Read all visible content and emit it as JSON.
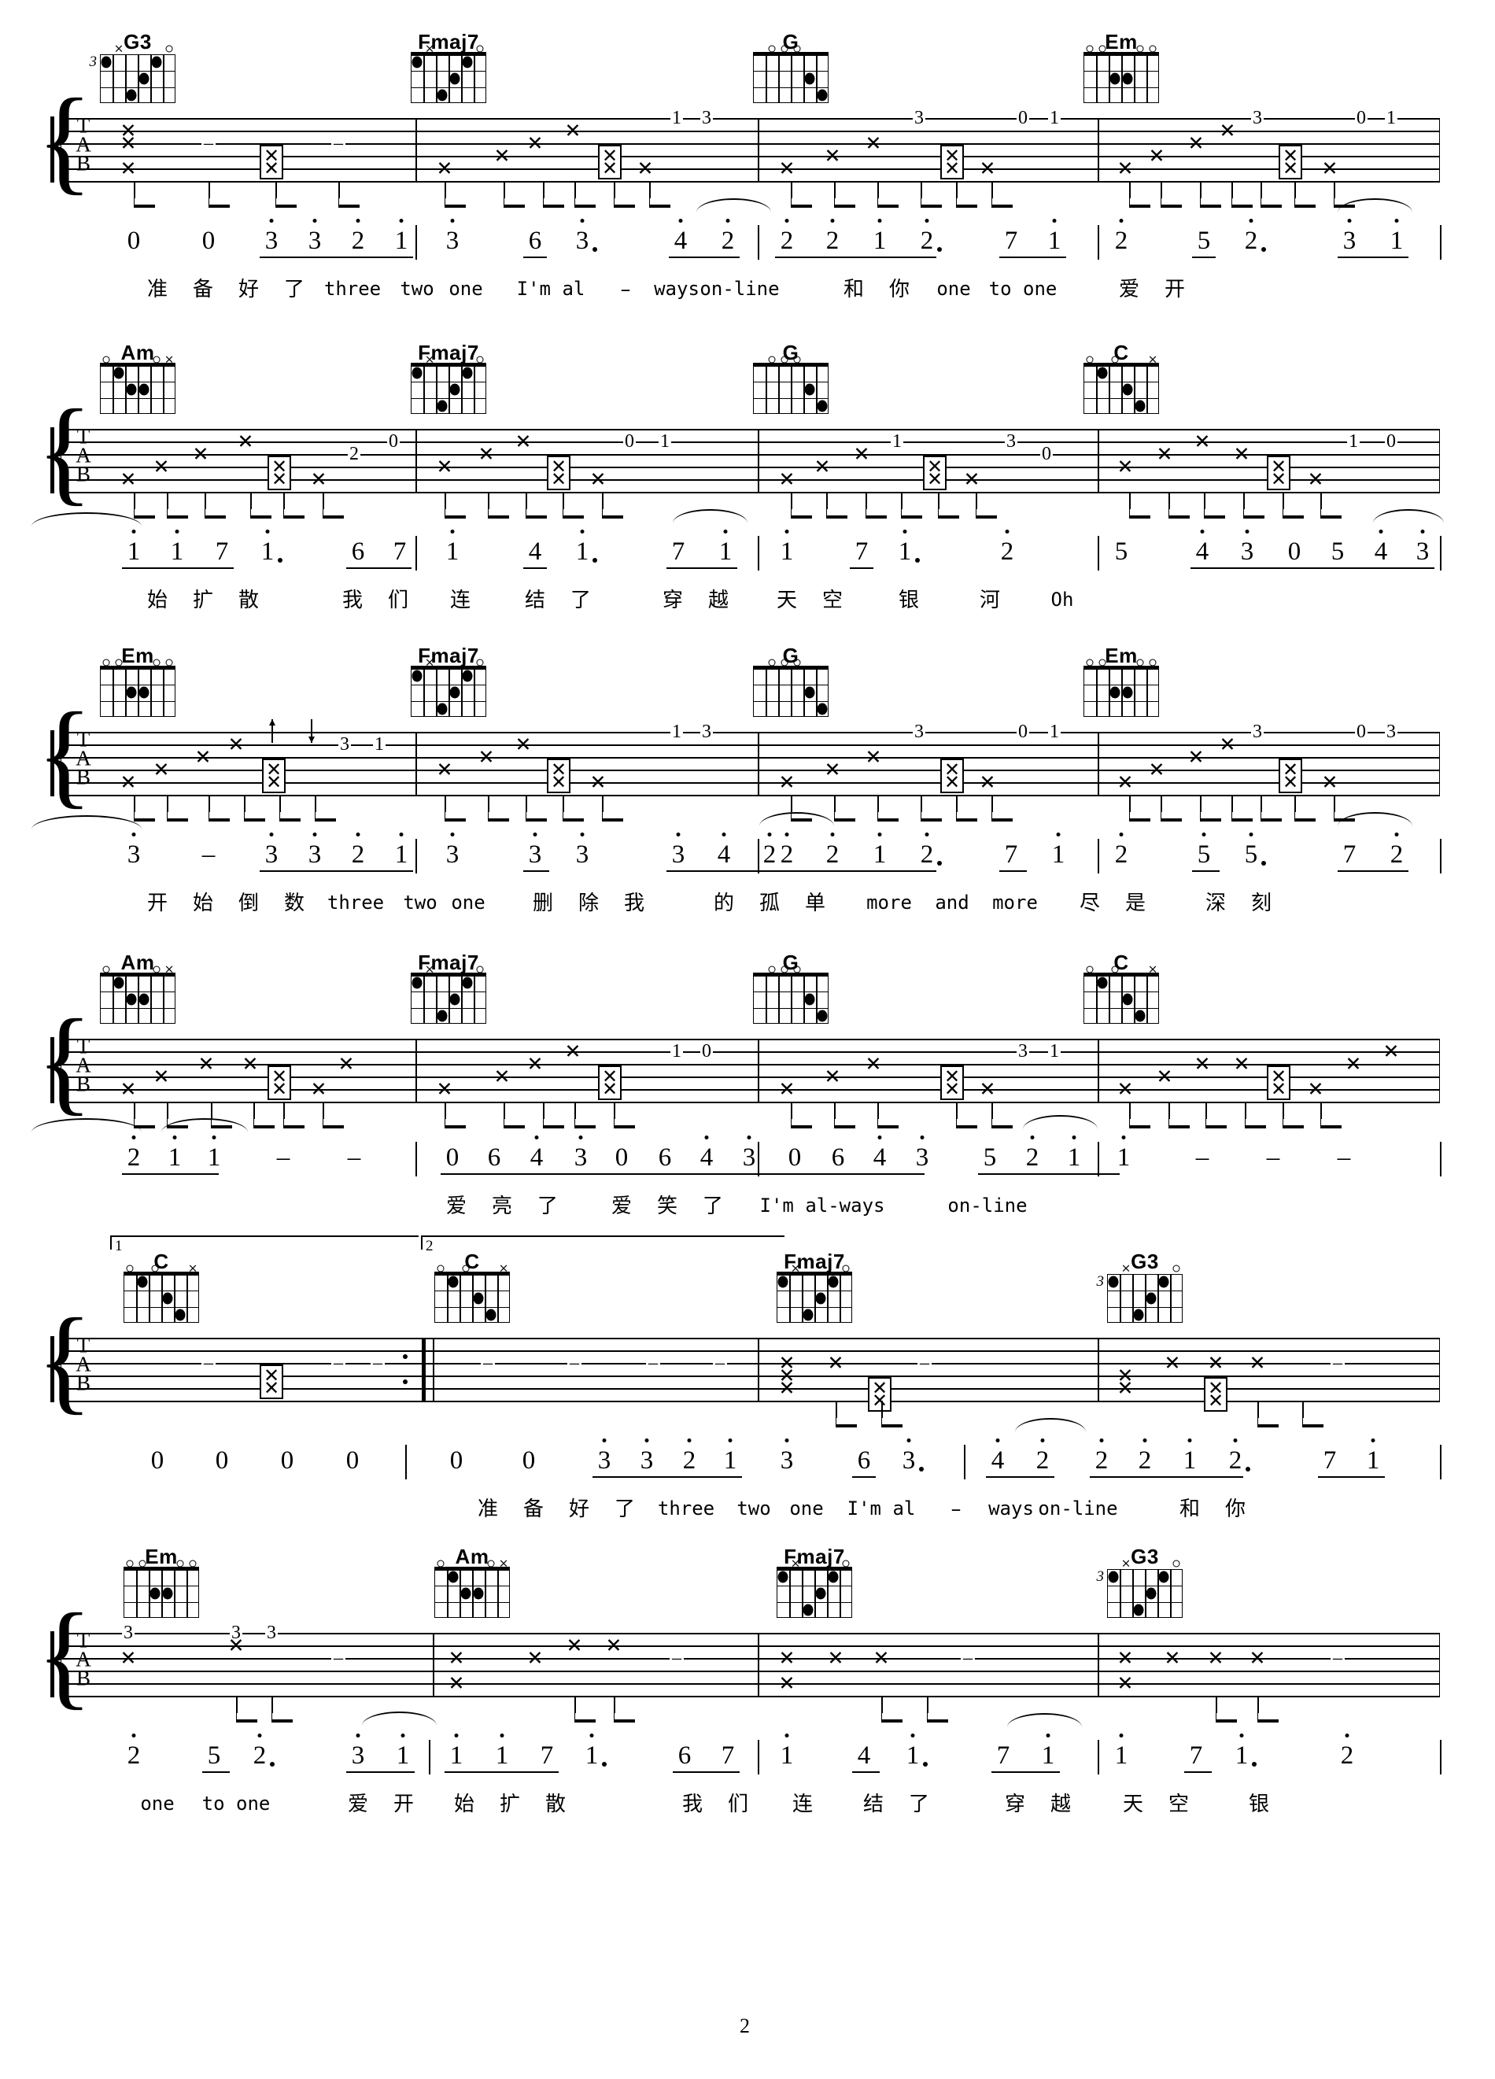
{
  "page": {
    "number": "2"
  },
  "systems": [
    {
      "id": "system-1",
      "chords": [
        "G3",
        "Fmaj7",
        "G",
        "Em"
      ],
      "tab_numbers": [
        "1",
        "3",
        "3",
        "0",
        "1",
        "3",
        "0",
        "1"
      ],
      "jianpu": "0  0  3 3 2 1 | 3  6 3. | 4 2 | 2 2 1 2. | 7 1 | 2  5 2. | 3 1 |",
      "notes": [
        "0",
        "0",
        "3",
        "3",
        "2",
        "1",
        "3",
        "6",
        "3.",
        "4",
        "2",
        "2",
        "2",
        "1",
        "2.",
        "7",
        "1",
        "2",
        "5",
        "2.",
        "3",
        "1"
      ],
      "lyrics": [
        "准",
        "备",
        "好",
        "了",
        "three",
        "two",
        "one",
        "I'm al",
        "-",
        "ways",
        "on-line",
        "和",
        "你",
        "one",
        "to one",
        "爱",
        "开"
      ]
    },
    {
      "id": "system-2",
      "chords": [
        "Am",
        "Fmaj7",
        "G",
        "C"
      ],
      "tab_numbers": [
        "2",
        "0",
        "0",
        "1",
        "1",
        "3",
        "0",
        "1",
        "0"
      ],
      "notes": [
        "1",
        "1",
        "7",
        "1.",
        "6",
        "7",
        "1",
        "4",
        "1.",
        "7",
        "1",
        "1",
        "7",
        "1.",
        "2",
        "5",
        "4",
        "3",
        "0",
        "5",
        "4",
        "3"
      ],
      "lyrics": [
        "始",
        "扩",
        "散",
        "我",
        "们",
        "连",
        "结",
        "了",
        "穿",
        "越",
        "天",
        "空",
        "银",
        "河",
        "Oh"
      ]
    },
    {
      "id": "system-3",
      "chords": [
        "Em",
        "Fmaj7",
        "G",
        "Em"
      ],
      "tab_numbers": [
        "3",
        "1",
        "1",
        "3",
        "3",
        "0",
        "1",
        "3",
        "0",
        "3"
      ],
      "notes": [
        "3",
        "-",
        "3",
        "3",
        "2",
        "1",
        "3",
        "3",
        "3",
        "3",
        "4",
        "2",
        "2",
        "2",
        "1",
        "2.",
        "7",
        "1",
        "2",
        "5",
        "5.",
        "7",
        "2"
      ],
      "lyrics": [
        "开",
        "始",
        "倒",
        "数",
        "three",
        "two",
        "one",
        "删",
        "除",
        "我",
        "的",
        "孤",
        "单",
        "more",
        "and",
        "more",
        "尽",
        "是",
        "深",
        "刻"
      ]
    },
    {
      "id": "system-4",
      "chords": [
        "Am",
        "Fmaj7",
        "G",
        "C"
      ],
      "tab_numbers": [
        "1",
        "0",
        "3",
        "1"
      ],
      "notes": [
        "2",
        "1",
        "1",
        "-",
        "-",
        "0",
        "6",
        "4",
        "3",
        "0",
        "6",
        "4",
        "3",
        "0",
        "6",
        "4",
        "3",
        "5",
        "2",
        "1",
        "1",
        "-",
        "-",
        "-"
      ],
      "lyrics": [
        "爱",
        "亮",
        "了",
        "爱",
        "笑",
        "了",
        "I'm al-ways",
        "on-line"
      ],
      "volta1": "1",
      "volta2": "2"
    },
    {
      "id": "system-5",
      "chords": [
        "C",
        "C",
        "Fmaj7",
        "G3"
      ],
      "notes": [
        "0",
        "0",
        "0",
        "0",
        "0",
        "0",
        "3",
        "3",
        "2",
        "1",
        "3",
        "6",
        "3.",
        "4",
        "2",
        "2",
        "2",
        "1",
        "2.",
        "7",
        "1"
      ],
      "lyrics": [
        "准",
        "备",
        "好",
        "了",
        "three",
        "two",
        "one",
        "I'm al",
        "-",
        "ways",
        "on-line",
        "和",
        "你"
      ]
    },
    {
      "id": "system-6",
      "chords": [
        "Em",
        "Am",
        "Fmaj7",
        "G3"
      ],
      "tab_numbers": [
        "3",
        "3",
        "3"
      ],
      "notes": [
        "2",
        "5",
        "2.",
        "3",
        "1",
        "1",
        "1",
        "7",
        "1.",
        "6",
        "7",
        "1",
        "4",
        "1.",
        "7",
        "1",
        "1",
        "7",
        "1.",
        "2"
      ],
      "lyrics": [
        "one",
        "to one",
        "爱",
        "开",
        "始",
        "扩",
        "散",
        "我",
        "们",
        "连",
        "结",
        "了",
        "穿",
        "越",
        "天",
        "空",
        "银"
      ]
    }
  ],
  "chord_shapes": {
    "G3": {
      "name": "G3",
      "fret": "3",
      "dots": [
        [
          1,
          1
        ],
        [
          5,
          1
        ],
        [
          4,
          2
        ],
        [
          3,
          3
        ]
      ],
      "open": [
        6
      ],
      "muted": [
        2
      ]
    },
    "Fmaj7": {
      "name": "Fmaj7",
      "fret": "",
      "dots": [
        [
          1,
          1
        ],
        [
          5,
          1
        ],
        [
          4,
          2
        ],
        [
          3,
          3
        ]
      ],
      "open": [
        6
      ],
      "muted": [
        2
      ]
    },
    "G": {
      "name": "G",
      "fret": "",
      "dots": [
        [
          5,
          2
        ],
        [
          6,
          3
        ]
      ],
      "open": [
        2,
        3,
        4
      ]
    },
    "Em": {
      "name": "Em",
      "fret": "",
      "dots": [
        [
          4,
          2
        ],
        [
          3,
          2
        ]
      ],
      "open": [
        1,
        2,
        5,
        6
      ]
    },
    "Am": {
      "name": "Am",
      "fret": "",
      "dots": [
        [
          2,
          1
        ],
        [
          4,
          2
        ],
        [
          3,
          2
        ]
      ],
      "open": [
        1,
        5
      ],
      "muted": [
        6
      ]
    },
    "C": {
      "name": "C",
      "fret": "",
      "dots": [
        [
          2,
          1
        ],
        [
          4,
          2
        ],
        [
          5,
          3
        ]
      ],
      "open": [
        1,
        3
      ],
      "muted": [
        6
      ]
    }
  },
  "staff_labels": {
    "t": "T",
    "a": "A",
    "b": "B"
  }
}
